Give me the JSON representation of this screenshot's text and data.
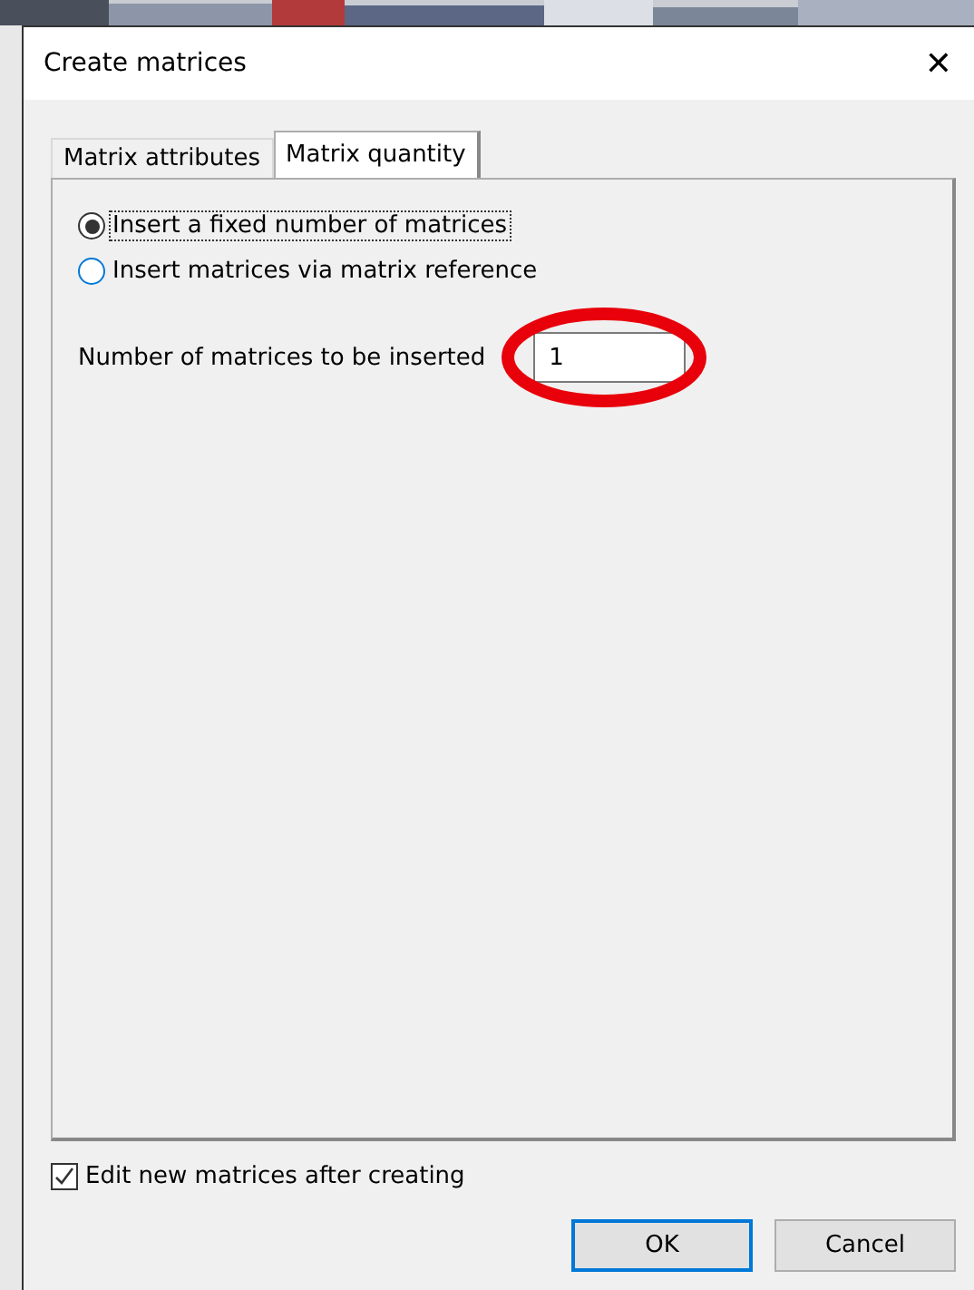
{
  "window": {
    "title": "Create matrices",
    "close": "✕"
  },
  "tabs": [
    {
      "label": "Matrix attributes",
      "selected": false
    },
    {
      "label": "Matrix quantity",
      "selected": true
    }
  ],
  "options": [
    {
      "label": "Insert a fixed number of matrices",
      "selected": true
    },
    {
      "label": "Insert matrices via matrix reference",
      "selected": false
    }
  ],
  "count_field": {
    "label": "Number of matrices to be inserted",
    "value": "1"
  },
  "edit_after": {
    "label": "Edit new matrices after creating",
    "checked": true
  },
  "buttons": [
    {
      "label": "OK",
      "default": true
    },
    {
      "label": "Cancel",
      "default": false
    }
  ]
}
